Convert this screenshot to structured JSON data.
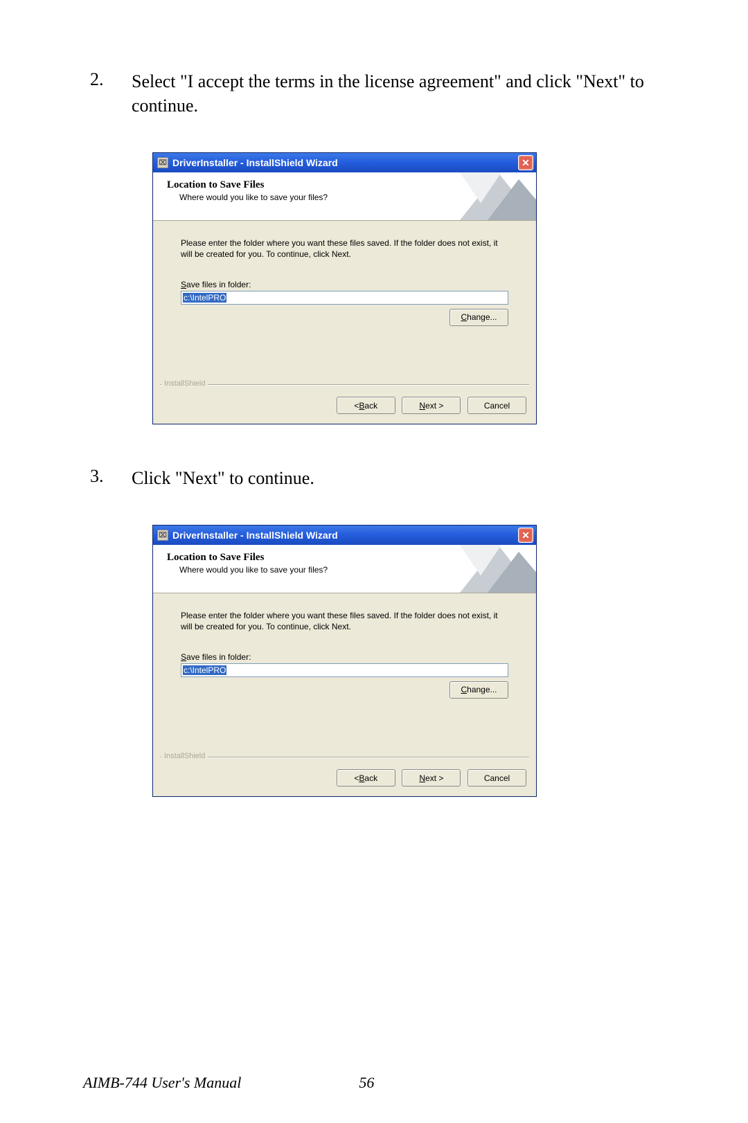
{
  "steps": [
    {
      "num": "2.",
      "text": "Select \"I accept the terms in the license agreement\" and click \"Next\" to continue."
    },
    {
      "num": "3.",
      "text": "Click \"Next\" to continue."
    }
  ],
  "dialog": {
    "title": "DriverInstaller - InstallShield Wizard",
    "header_title": "Location to Save Files",
    "header_sub": "Where would you like to save your files?",
    "body_desc": "Please enter the folder where you want these files saved.  If the folder does not exist, it will be created for you.  To continue, click Next.",
    "field_label_pre": "S",
    "field_label_rest": "ave files in folder:",
    "path_value": "c:\\IntelPRO",
    "change_pre": "C",
    "change_rest": "hange...",
    "brand": "InstallShield",
    "back_lt": "< ",
    "back_pre": "B",
    "back_rest": "ack",
    "next_pre": "N",
    "next_rest": "ext >",
    "cancel": "Cancel",
    "close_glyph": "✕"
  },
  "footer": {
    "manual": "AIMB-744 User's Manual",
    "page": "56"
  }
}
